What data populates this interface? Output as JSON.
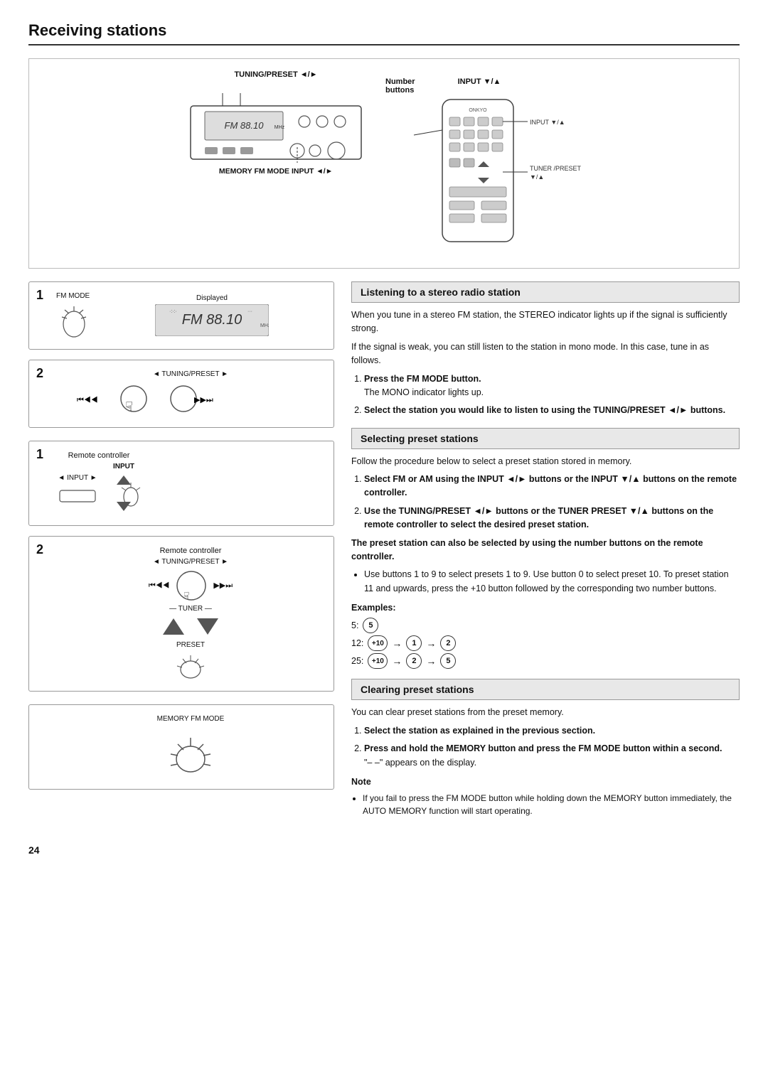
{
  "page": {
    "title": "Receiving stations",
    "number": "24"
  },
  "top_diagram": {
    "tuning_preset_label": "TUNING/PRESET ◄/►",
    "memory_fm_input_label": "MEMORY  FM MODE  INPUT ◄/►",
    "number_buttons_label": "Number\nbuttons",
    "input_label": "INPUT ▼/▲",
    "tuner_preset_label": "TUNER /PRESET\n▼/▲"
  },
  "stereo_section": {
    "header": "Listening to a stereo radio station",
    "body": "When you tune in a stereo FM station, the STEREO indicator lights up if the signal is sufficiently strong.",
    "body2": "If the signal is weak, you can still listen to the station in mono mode. In this case, tune in as follows.",
    "step1": "Press the FM MODE button.",
    "step1_sub": "The MONO indicator lights up.",
    "step2": "Select the station you would like to listen to using the TUNING/PRESET ◄/► buttons."
  },
  "selecting_section": {
    "header": "Selecting preset stations",
    "body": "Follow the procedure below to select a preset station stored in memory.",
    "step1": "Select FM or AM using the INPUT ◄/► buttons or the INPUT ▼/▲ buttons on the remote controller.",
    "step2": "Use the TUNING/PRESET ◄/► buttons or the TUNER PRESET ▼/▲ buttons on the remote controller to select the desired preset station.",
    "bold_note": "The preset station can also be selected by using the number buttons on the remote controller.",
    "bullet": "Use buttons 1 to 9 to select presets 1 to 9. Use button 0 to select preset 10. To preset station 11 and upwards, press the +10 button followed by the corresponding two number buttons.",
    "examples_label": "Examples:",
    "ex1_num": "5:",
    "ex1_btn": "5",
    "ex2_num": "12:",
    "ex2_btn1": "+10",
    "ex2_btn2": "1",
    "ex2_btn3": "2",
    "ex3_num": "25:",
    "ex3_btn1": "+10",
    "ex3_btn2": "2",
    "ex3_btn3": "5"
  },
  "clearing_section": {
    "header": "Clearing preset stations",
    "body": "You can clear preset stations from the preset memory.",
    "step1": "Select the station as explained in the previous section.",
    "step2": "Press and hold the MEMORY button and press the FM MODE button within a second.",
    "step2_sub": "\"– –\" appears on the display.",
    "note_title": "Note",
    "note_bullet": "If you fail to press the FM MODE button while holding down the MEMORY button immediately, the AUTO MEMORY function will start operating."
  },
  "step_labels": {
    "remote_controller": "Remote controller",
    "tuning_preset": "◄ TUNING/PRESET ►",
    "input_arrow": "◄ INPUT ►",
    "tuner_label": "— TUNER —",
    "preset_label": "PRESET",
    "input_btn": "INPUT",
    "memory_fm_mode": "MEMORY  FM MODE",
    "displayed": "Displayed",
    "fm_mode": "FM MODE"
  }
}
